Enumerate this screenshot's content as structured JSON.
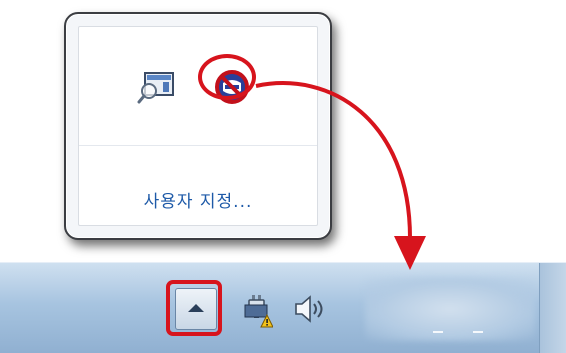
{
  "popup": {
    "customize_label": "사용자 지정..."
  },
  "tray_icons": {
    "popup_icons": [
      "search-window-icon",
      "blocked-icon"
    ],
    "taskbar_icons": [
      "show-hidden-icons-button",
      "network-warning-icon",
      "volume-icon"
    ]
  },
  "colors": {
    "annotation_red": "#d7141d",
    "customize_link": "#1e5aa8",
    "taskbar_top": "#cfe0f0",
    "taskbar_bottom": "#90b0d1"
  }
}
